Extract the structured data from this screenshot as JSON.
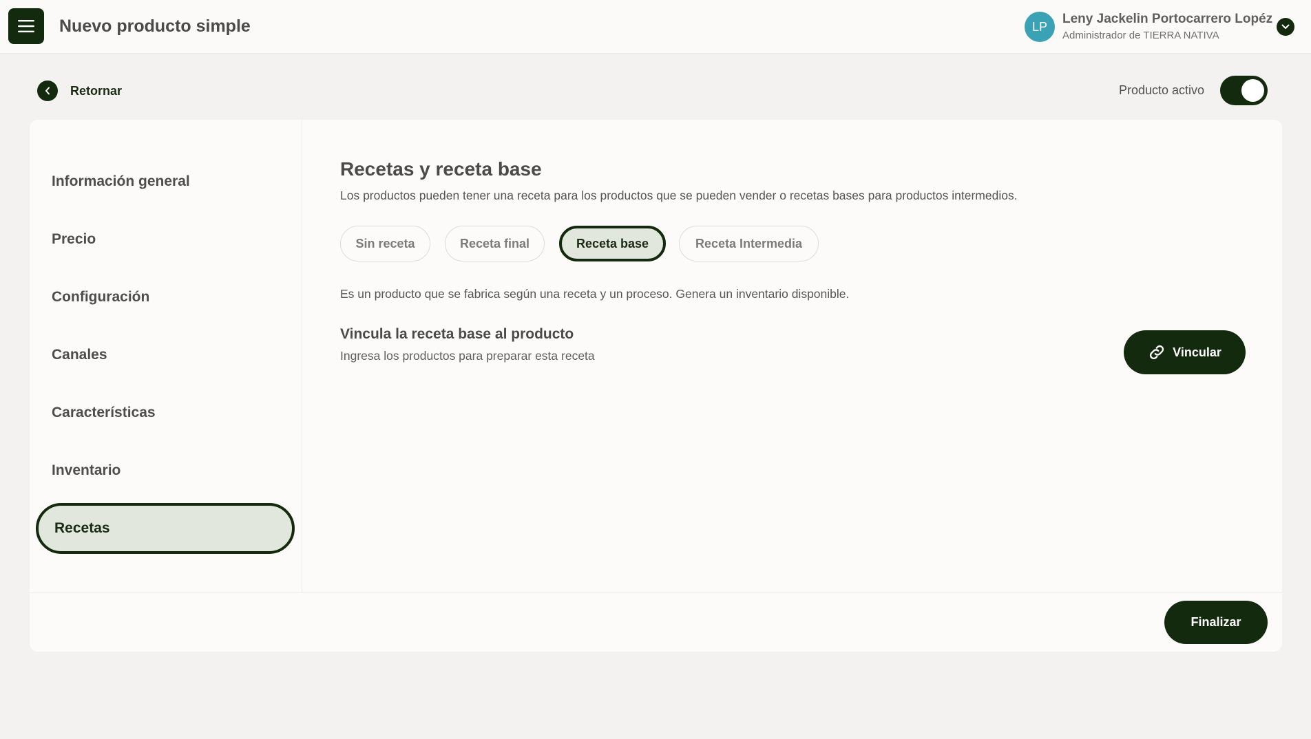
{
  "header": {
    "title": "Nuevo producto simple",
    "menu_icon": "hamburger-menu-icon",
    "user": {
      "initials": "LP",
      "name": "Leny Jackelin Portocarrero Lopéz",
      "role": "Administrador de TIERRA NATIVA",
      "avatar_color": "#3aa2b4"
    }
  },
  "back": {
    "label": "Retornar"
  },
  "status": {
    "label": "Producto activo",
    "active": true
  },
  "sidebar": {
    "items": [
      {
        "label": "Información general",
        "active": false
      },
      {
        "label": "Precio",
        "active": false
      },
      {
        "label": "Configuración",
        "active": false
      },
      {
        "label": "Canales",
        "active": false
      },
      {
        "label": "Características",
        "active": false
      },
      {
        "label": "Inventario",
        "active": false
      },
      {
        "label": "Recetas",
        "active": true
      }
    ]
  },
  "main": {
    "title": "Recetas y receta base",
    "description": "Los productos pueden tener una receta para los productos que se pueden vender o recetas bases para productos intermedios.",
    "tabs": [
      {
        "label": "Sin receta",
        "active": false
      },
      {
        "label": "Receta final",
        "active": false
      },
      {
        "label": "Receta base",
        "active": true
      },
      {
        "label": "Receta Intermedia",
        "active": false
      }
    ],
    "type_description": "Es un producto que se fabrica según una receta y un proceso. Genera un inventario disponible.",
    "link_section": {
      "title": "Vincula la receta base al producto",
      "subtitle": "Ingresa los productos para preparar esta receta",
      "button_label": "Vincular",
      "button_icon": "link-icon"
    }
  },
  "footer": {
    "finish_label": "Finalizar"
  },
  "colors": {
    "primary": "#142a0e",
    "active_bg": "#e2e7dd",
    "page_bg": "#f3f2f0",
    "card_bg": "#fcfbf9"
  }
}
